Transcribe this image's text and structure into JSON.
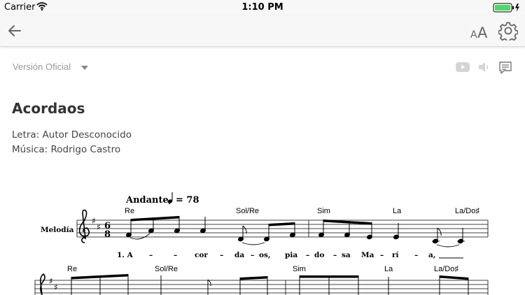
{
  "status_bar": {
    "carrier": "Carrier",
    "time": "1:10 PM"
  },
  "nav": {
    "back_icon": "arrow-left-icon",
    "font_size_icon": "font-size-icon",
    "settings_icon": "gear-icon"
  },
  "toolbar": {
    "version_label": "Versión Oficial",
    "icons": [
      "youtube-icon",
      "speaker-icon",
      "comment-icon"
    ]
  },
  "song": {
    "title": "Acordaos",
    "lyricist": "Letra: Autor Desconocido",
    "composer": "Música: Rodrigo Castro"
  },
  "score": {
    "tempo_text": "Andante,",
    "tempo_value": "= 78",
    "part_name": "Melodía",
    "time_signature": [
      "6",
      "8"
    ],
    "chords_row1": [
      "Re",
      "Sol/Re",
      "Sim",
      "La",
      "La/Do♯"
    ],
    "chords_row2": [
      "Re",
      "Sol/Re",
      "Sim",
      "La",
      "La/Do♯"
    ],
    "lyrics_row1": [
      "1. A",
      "–",
      "–",
      "cor",
      "–",
      "da",
      "–",
      "os,",
      "pia",
      "–",
      "do",
      "–",
      "sa",
      "Ma",
      "–",
      "rí",
      "–",
      "a,"
    ]
  },
  "colors": {
    "nav_bg": "#f7f7f7",
    "icon_gray": "#666666",
    "muted_text": "#999999"
  }
}
